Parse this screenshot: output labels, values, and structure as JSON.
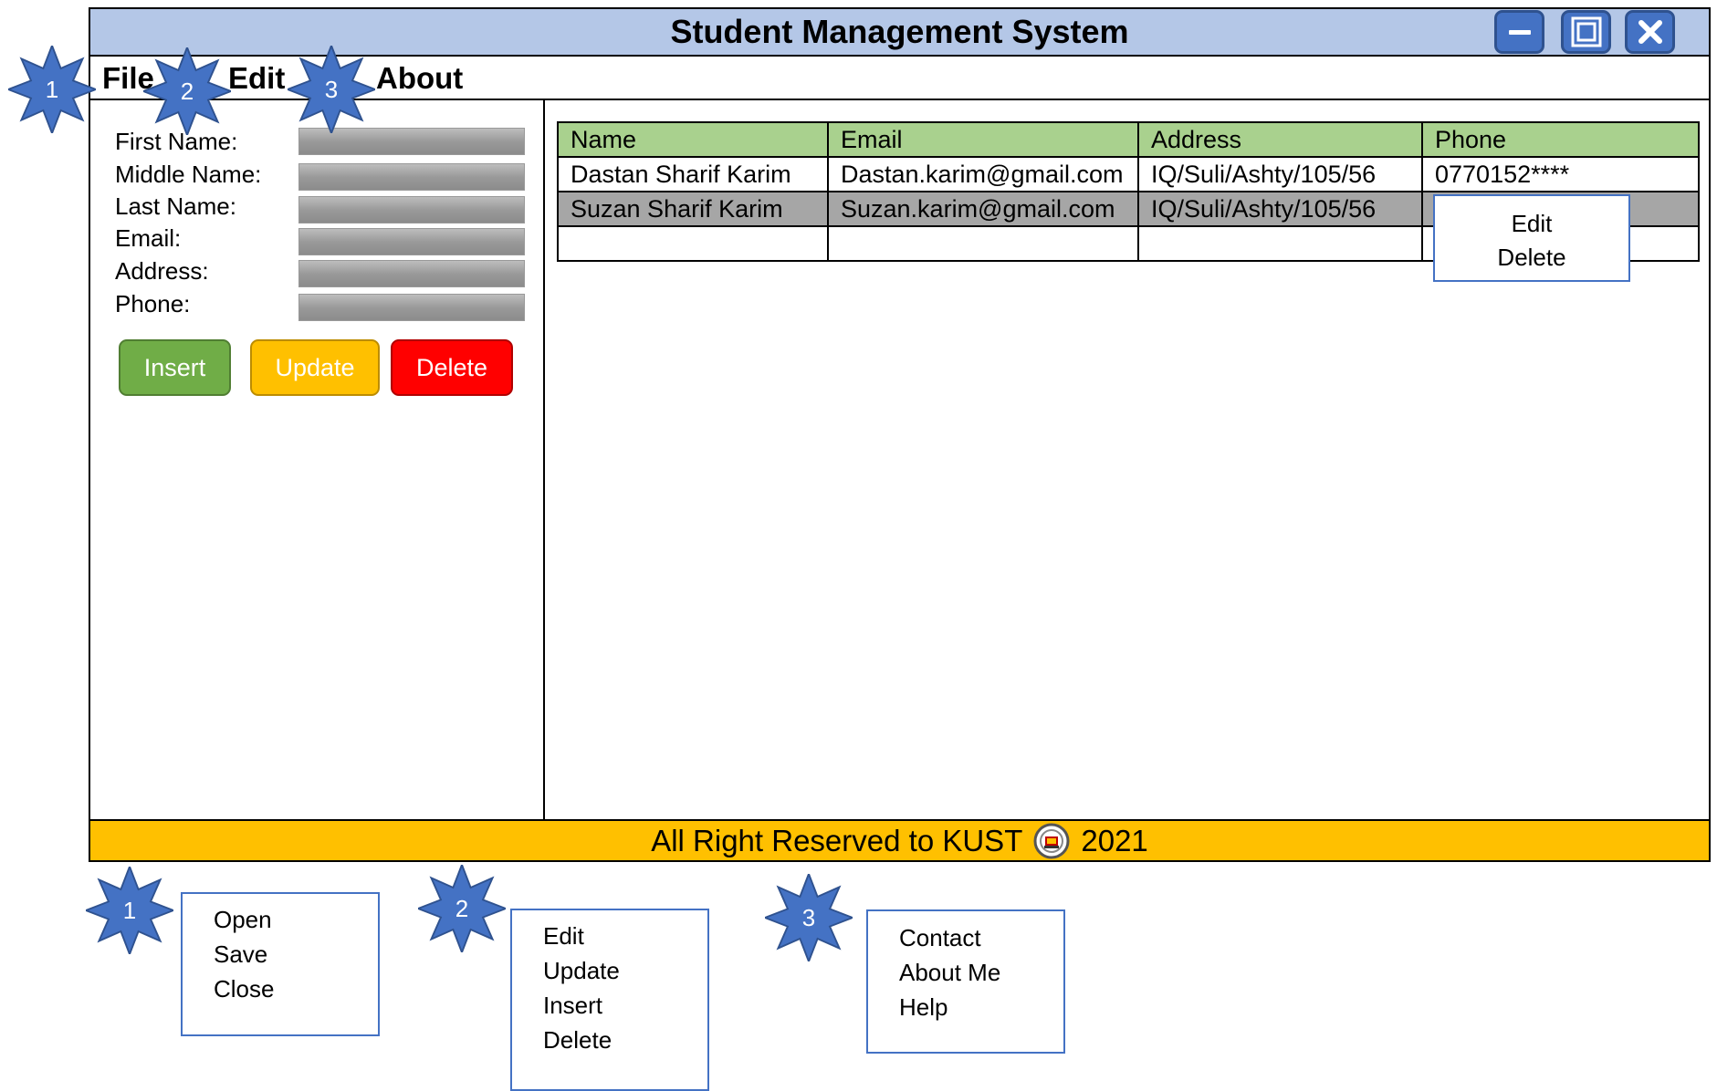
{
  "window": {
    "title": "Student Management System"
  },
  "menu": {
    "file": "File",
    "edit": "Edit",
    "about": "About"
  },
  "form": {
    "labels": [
      "First Name:",
      "Middle Name:",
      "Last Name:",
      "Email:",
      "Address:",
      "Phone:"
    ],
    "buttons": {
      "insert": "Insert",
      "update": "Update",
      "delete": "Delete"
    }
  },
  "table": {
    "headers": [
      "Name",
      "Email",
      "Address",
      "Phone"
    ],
    "rows": [
      [
        "Dastan Sharif Karim",
        "Dastan.karim@gmail.com",
        "IQ/Suli/Ashty/105/56",
        "0770152****"
      ],
      [
        "Suzan Sharif Karim",
        "Suzan.karim@gmail.com",
        "IQ/Suli/Ashty/105/56",
        ""
      ],
      [
        "",
        "",
        "",
        ""
      ]
    ]
  },
  "context_menu": [
    "Edit",
    "Delete"
  ],
  "footer": {
    "text": "All Right Reserved to KUST",
    "year": "2021"
  },
  "annotations": {
    "badges": [
      "1",
      "2",
      "3"
    ],
    "file_menu": [
      "Open",
      "Save",
      "Close"
    ],
    "edit_menu": [
      "Edit",
      "Update",
      "Insert",
      "Delete"
    ],
    "about_menu": [
      "Contact",
      "About Me",
      "Help"
    ]
  },
  "colors": {
    "titlebar": "#b4c7e7",
    "header_row": "#a9d18e",
    "footer": "#ffc000",
    "badge": "#4472c4",
    "insert": "#70ad47",
    "update": "#ffc000",
    "delete": "#ff0000"
  },
  "icons": {
    "minimize": "minimize-icon",
    "maximize": "maximize-icon",
    "close": "close-icon",
    "logo": "kust-logo-icon"
  }
}
